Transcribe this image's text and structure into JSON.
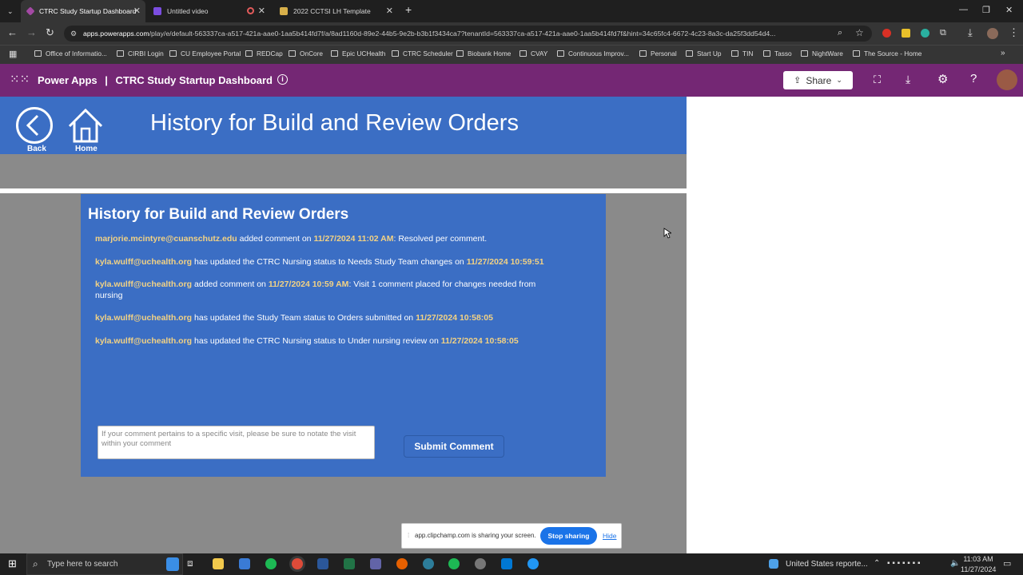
{
  "browser": {
    "tabs": [
      {
        "title": "CTRC Study Startup Dashboard",
        "active": true
      },
      {
        "title": "Untitled video",
        "active": false
      },
      {
        "title": "2022 CCTSI LH Template",
        "active": false
      }
    ],
    "url_host": "apps.powerapps.com",
    "url_rest": "/play/e/default-563337ca-a517-421a-aae0-1aa5b414fd7f/a/8ad1160d-89e2-44b5-9e2b-b3b1f3434ca7?tenantId=563337ca-a517-421a-aae0-1aa5b414fd7f&hint=34c65fc4-6672-4c23-8a3c-da25f3dd54d4...",
    "bookmarks": [
      "Office of Informatio...",
      "CIRBI Login",
      "CU Employee Portal",
      "REDCap",
      "OnCore",
      "Epic UCHealth",
      "CTRC Scheduler",
      "Biobank Home",
      "CVAY",
      "Continuous Improv...",
      "Personal",
      "Start Up",
      "TIN",
      "Tasso",
      "NightWare",
      "The Source - Home"
    ]
  },
  "powerapps": {
    "brand": "Power Apps",
    "separator": "|",
    "app_name": "CTRC Study Startup Dashboard",
    "share_label": "Share"
  },
  "page": {
    "title": "History for Build and Review Orders",
    "back_label": "Back",
    "home_label": "Home"
  },
  "panel": {
    "title": "History for Build and Review Orders",
    "entries": [
      {
        "user": "marjorie.mcintyre@cuanschutz.edu",
        "action": " added comment on ",
        "time": "11/27/2024 11:02 AM",
        "rest": ": Resolved per comment."
      },
      {
        "user": "kyla.wulff@uchealth.org",
        "action": " has updated the CTRC Nursing status to Needs Study Team changes on ",
        "time": "11/27/2024 10:59:51",
        "rest": ""
      },
      {
        "user": "kyla.wulff@uchealth.org",
        "action": " added comment on ",
        "time": "11/27/2024 10:59 AM",
        "rest": ": Visit 1 comment placed for changes needed from nursing"
      },
      {
        "user": "kyla.wulff@uchealth.org",
        "action": " has updated the Study Team status to Orders submitted on ",
        "time": "11/27/2024 10:58:05",
        "rest": ""
      },
      {
        "user": "kyla.wulff@uchealth.org",
        "action": " has updated the CTRC Nursing status to Under nursing review on ",
        "time": "11/27/2024 10:58:05",
        "rest": ""
      }
    ],
    "comment_placeholder": "If your comment pertains to a specific visit, please be sure to notate the visit within your comment",
    "submit_label": "Submit Comment"
  },
  "share_notice": {
    "text": "app.clipchamp.com is sharing your screen.",
    "stop_label": "Stop sharing",
    "hide_label": "Hide"
  },
  "taskbar": {
    "search_placeholder": "Type here to search",
    "weather": "United States reporte...",
    "time": "11:03 AM",
    "date": "11/27/2024"
  },
  "colors": {
    "powerapps_header": "#742774",
    "app_blue": "#3b6ec4",
    "highlight": "#f2d284",
    "canvas_gray": "#8a8a8a"
  }
}
